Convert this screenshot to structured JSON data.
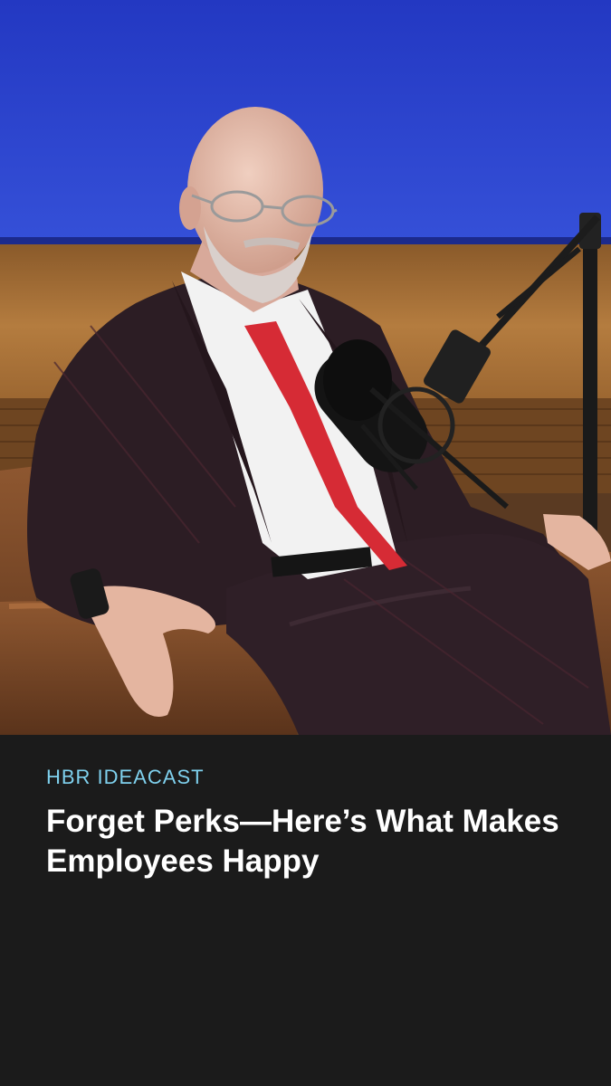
{
  "image": {
    "icon": "podcast-guest-photo",
    "colors": {
      "backdrop": "#2a3fc9",
      "panel": "#b07a3e",
      "chair": "#7a4a26",
      "suit": "#2c1d24",
      "tie": "#d62b35"
    }
  },
  "caption": {
    "kicker": "HBR IDEACAST",
    "headline": "Forget Perks—Here’s What Makes Employees Happy",
    "colors": {
      "kicker": "#7fd1ee",
      "headline": "#ffffff",
      "background": "#1b1b1b"
    }
  }
}
